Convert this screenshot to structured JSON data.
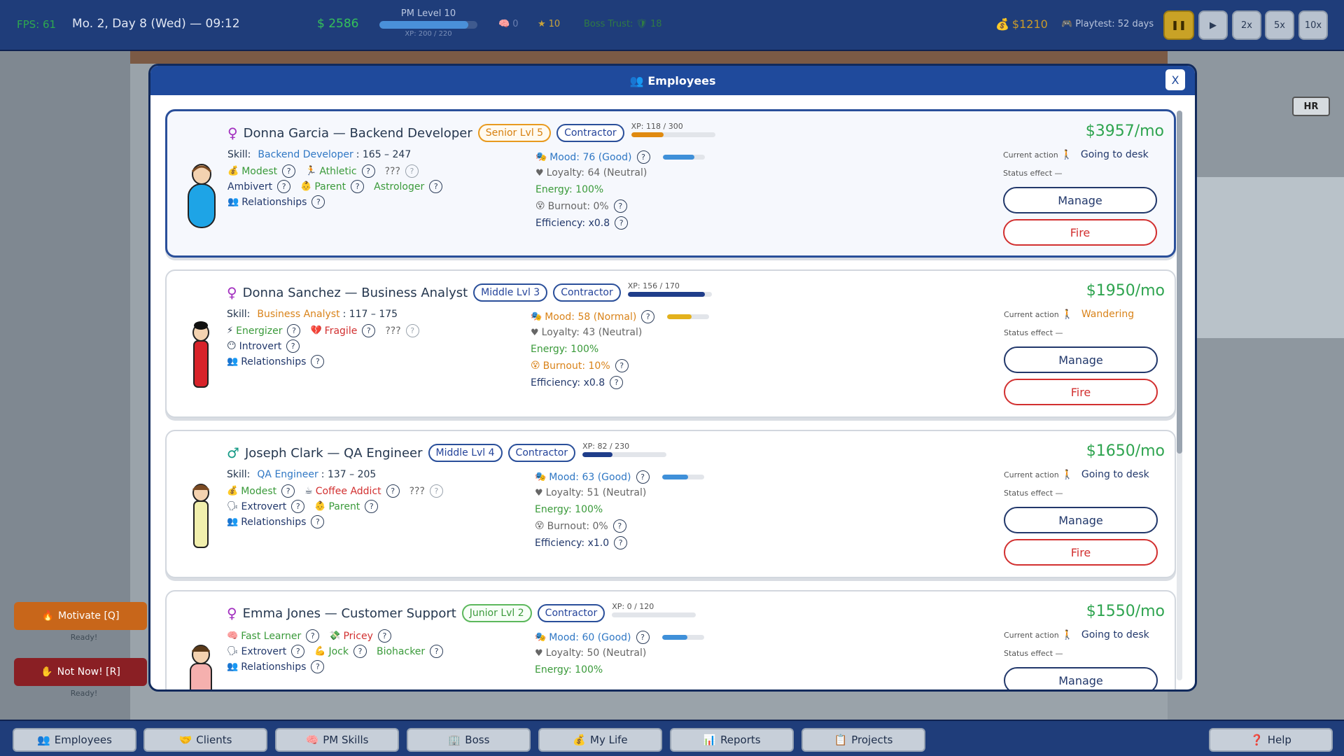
{
  "topbar": {
    "fps": "FPS: 61",
    "date": "Mo. 2, Day 8 (Wed) — 09:12",
    "money": "$ 2586",
    "pm_level": "PM Level 10",
    "pm_xp": "XP: 200 / 220",
    "pm_progress": 0.91,
    "brain": "0",
    "stars": "10",
    "boss_trust_label": "Boss Trust:",
    "boss_trust": "18",
    "wallet": "$1210",
    "playtest": "Playtest: 52 days",
    "speeds": [
      "2x",
      "5x",
      "10x"
    ]
  },
  "scene": {
    "hr": "HR",
    "motivate": "Motivate [Q]",
    "motivate_status": "Ready!",
    "notnow": "Not Now! [R]",
    "notnow_status": "Ready!"
  },
  "modal": {
    "title": "Employees",
    "close": "X"
  },
  "labels": {
    "skill": "Skill:",
    "relationships": "Relationships",
    "current_action": "Current action",
    "status_effect": "Status effect",
    "status_none": "—",
    "manage": "Manage",
    "fire": "Fire",
    "unknown": "???"
  },
  "employees": [
    {
      "name": "Donna Garcia — Backend Developer",
      "gender": "♀",
      "level": "Senior  Lvl 5",
      "contract": "Contractor",
      "xp": "XP: 118 / 300",
      "xp_progress": 0.39,
      "skill_name": "Backend Developer",
      "skill_range": ": 165 – 247",
      "traits1": [
        "Modest",
        "Athletic"
      ],
      "traits2": [
        "Ambivert",
        "Parent",
        "Astrologer"
      ],
      "mood": "Mood: 76 (Good)",
      "mood_level": 0.76,
      "loyalty": "Loyalty: 64 (Neutral)",
      "energy": "Energy: 100%",
      "burnout": "Burnout: 0%",
      "efficiency": "Efficiency: x0.8",
      "salary": "$3957/mo",
      "action": "Going to desk"
    },
    {
      "name": "Donna Sanchez — Business Analyst",
      "gender": "♀",
      "level": "Middle  Lvl 3",
      "contract": "Contractor",
      "xp": "XP: 156 / 170",
      "xp_progress": 0.92,
      "skill_name": "Business Analyst",
      "skill_range": ": 117 – 175",
      "traits1": [
        "Energizer",
        "Fragile"
      ],
      "traits2": [
        "Introvert"
      ],
      "mood": "Mood: 58 (Normal)",
      "mood_level": 0.58,
      "loyalty": "Loyalty: 43 (Neutral)",
      "energy": "Energy: 100%",
      "burnout": "Burnout: 10%",
      "efficiency": "Efficiency: x0.8",
      "salary": "$1950/mo",
      "action": "Wandering"
    },
    {
      "name": "Joseph Clark — QA Engineer",
      "gender": "♂",
      "level": "Middle  Lvl 4",
      "contract": "Contractor",
      "xp": "XP: 82 / 230",
      "xp_progress": 0.36,
      "skill_name": "QA Engineer",
      "skill_range": ": 137 – 205",
      "traits1": [
        "Modest",
        "Coffee Addict"
      ],
      "traits2": [
        "Extrovert",
        "Parent"
      ],
      "mood": "Mood: 63 (Good)",
      "mood_level": 0.63,
      "loyalty": "Loyalty: 51 (Neutral)",
      "energy": "Energy: 100%",
      "burnout": "Burnout: 0%",
      "efficiency": "Efficiency: x1.0",
      "salary": "$1650/mo",
      "action": "Going to desk"
    },
    {
      "name": "Emma Jones — Customer Support",
      "gender": "♀",
      "level": "Junior  Lvl 2",
      "contract": "Contractor",
      "xp": "XP: 0 / 120",
      "xp_progress": 0,
      "traits1": [
        "Fast Learner",
        "Pricey"
      ],
      "traits2": [
        "Extrovert",
        "Jock",
        "Biohacker"
      ],
      "mood": "Mood: 60 (Good)",
      "mood_level": 0.6,
      "loyalty": "Loyalty: 50 (Neutral)",
      "energy": "Energy: 100%",
      "salary": "$1550/mo",
      "action": "Going to desk"
    }
  ],
  "bottombar": [
    "Employees",
    "Clients",
    "PM Skills",
    "Boss",
    "My Life",
    "Reports",
    "Projects",
    "Help"
  ],
  "colors": {
    "header": "#1f4a9c",
    "topbar": "#1f3d7a",
    "salary": "#2ea44f",
    "fire": "#d23030"
  }
}
